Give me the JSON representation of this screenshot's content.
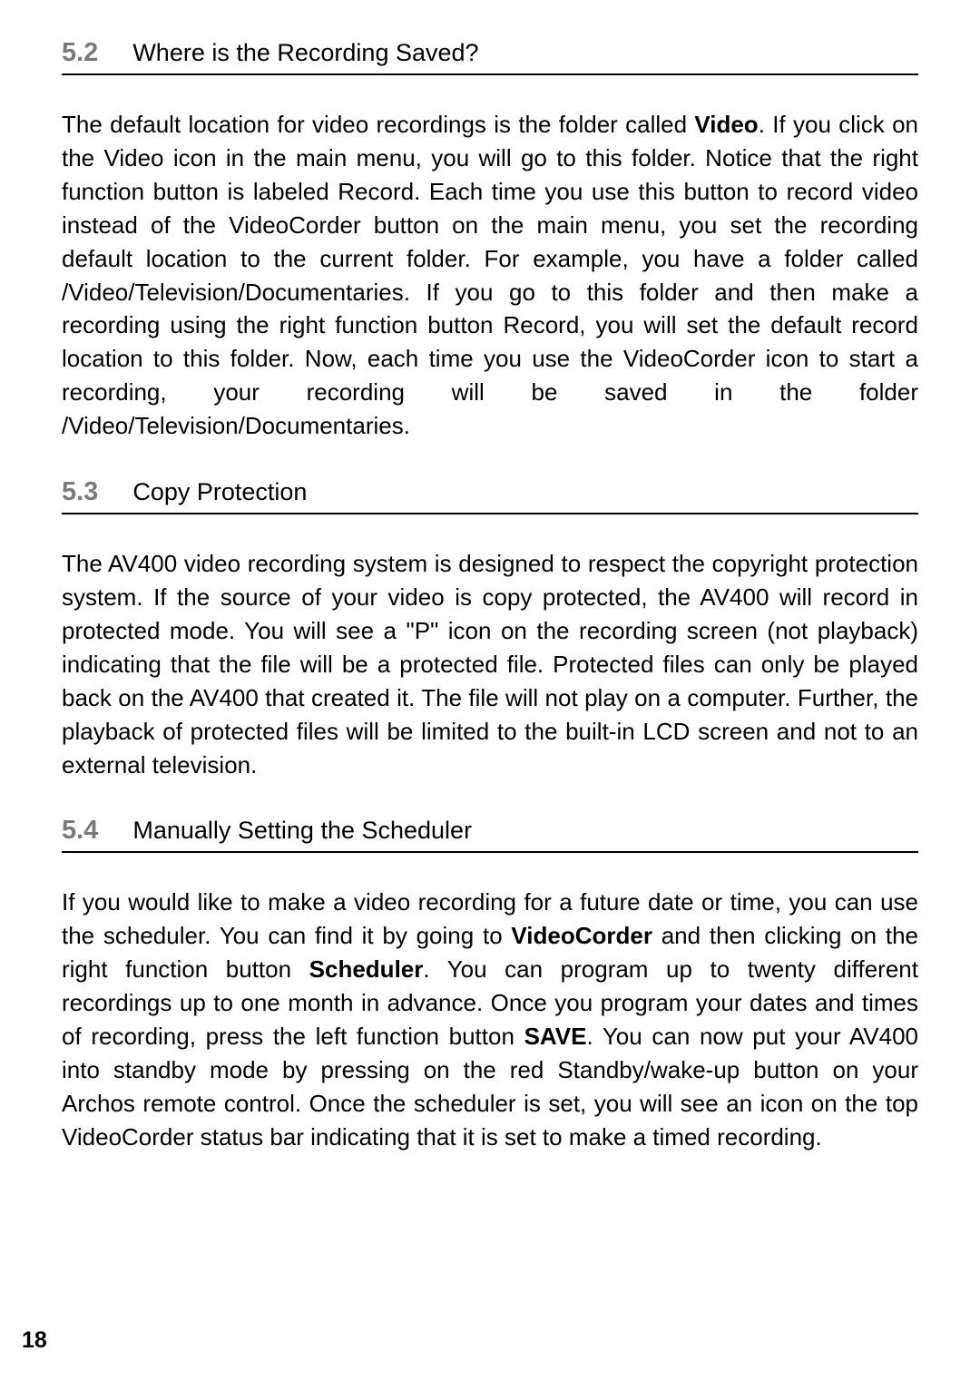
{
  "sections": [
    {
      "number": "5.2",
      "title": "Where is the Recording Saved?",
      "body_pre": "The default location for video recordings is the folder called ",
      "bold1": "Video",
      "body_post": ". If you click on the Video icon in the main menu, you will go to this folder. Notice that the right function button is labeled Record. Each time you use this button to record video instead of the VideoCorder button on the main menu, you set the recording default location to the current folder. For example, you have a folder called /Video/Television/Documentaries. If you go to this folder and then make a recording using the right function button Record, you will set the default record location to this folder. Now, each time you use the VideoCorder icon to start a recording, your recording will be saved in the folder /Video/Television/Documentaries."
    },
    {
      "number": "5.3",
      "title": "Copy Protection",
      "body": "The AV400 video recording system is designed to respect the copyright protection system. If the source of your video is copy protected, the AV400 will record in protected mode. You will see a \"P\" icon on the recording screen (not playback) indicating that the file will be a protected file. Protected files can only be played back on the AV400 that created it. The file will not play on a computer. Further, the playback of protected files will be limited to the built-in LCD screen and not to an external television."
    },
    {
      "number": "5.4",
      "title": "Manually Setting the Scheduler",
      "body_p1": "If you would like to make a video recording for a future date or time, you can use the scheduler. You can find it by going to ",
      "bold1": "VideoCorder",
      "body_p2": " and then clicking on the right function button ",
      "bold2": "Scheduler",
      "body_p3": ". You can program up to twenty different recordings up to one month in advance. Once you program your dates and times of recording, press the left function button ",
      "bold3": "SAVE",
      "body_p4": ". You can now put your AV400 into standby mode by pressing on the red Standby/wake-up button on your Archos remote control. Once the scheduler is set, you will see an icon on the top VideoCorder status bar indicating that it is set to make a timed recording."
    }
  ],
  "page_number": "18"
}
